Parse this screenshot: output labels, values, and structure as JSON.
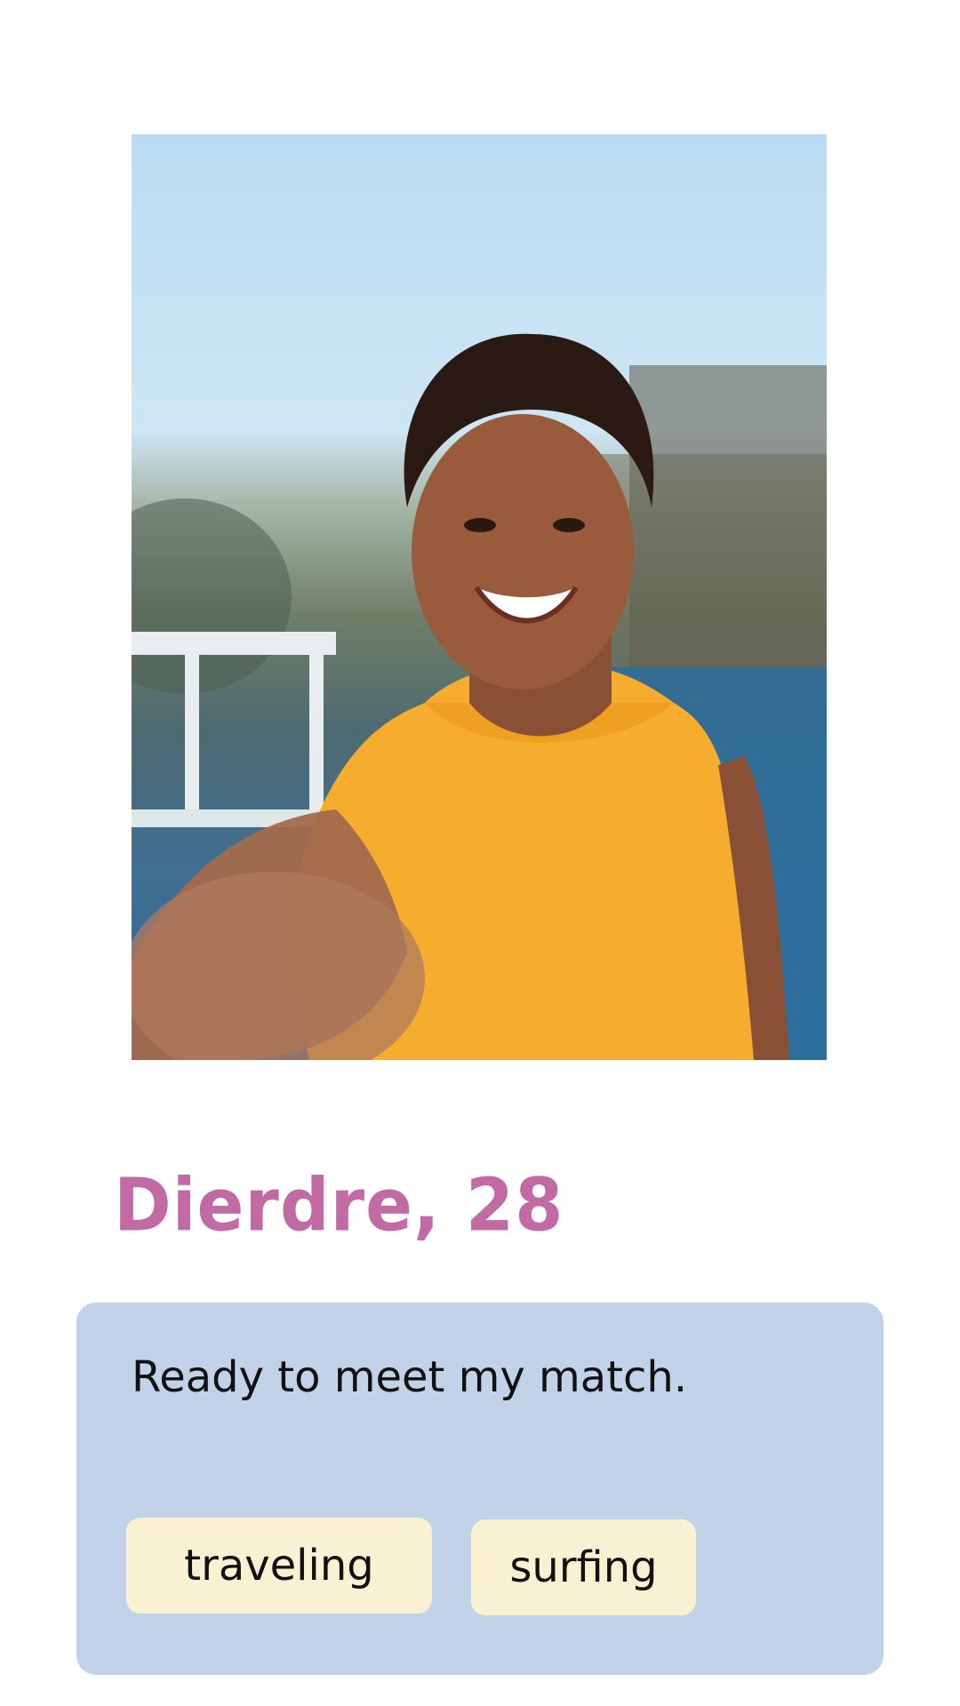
{
  "profile": {
    "name_age": "Dierdre, 28",
    "bio": "Ready to meet my match.",
    "interests": [
      "traveling",
      "surfing"
    ]
  },
  "photo": {
    "icon": "profile-photo-selfie"
  },
  "colors": {
    "name": "#c26aa4",
    "card_background": "#c2d2e9",
    "tag_background": "#f8f2d2",
    "page_background": "#ffffff"
  }
}
